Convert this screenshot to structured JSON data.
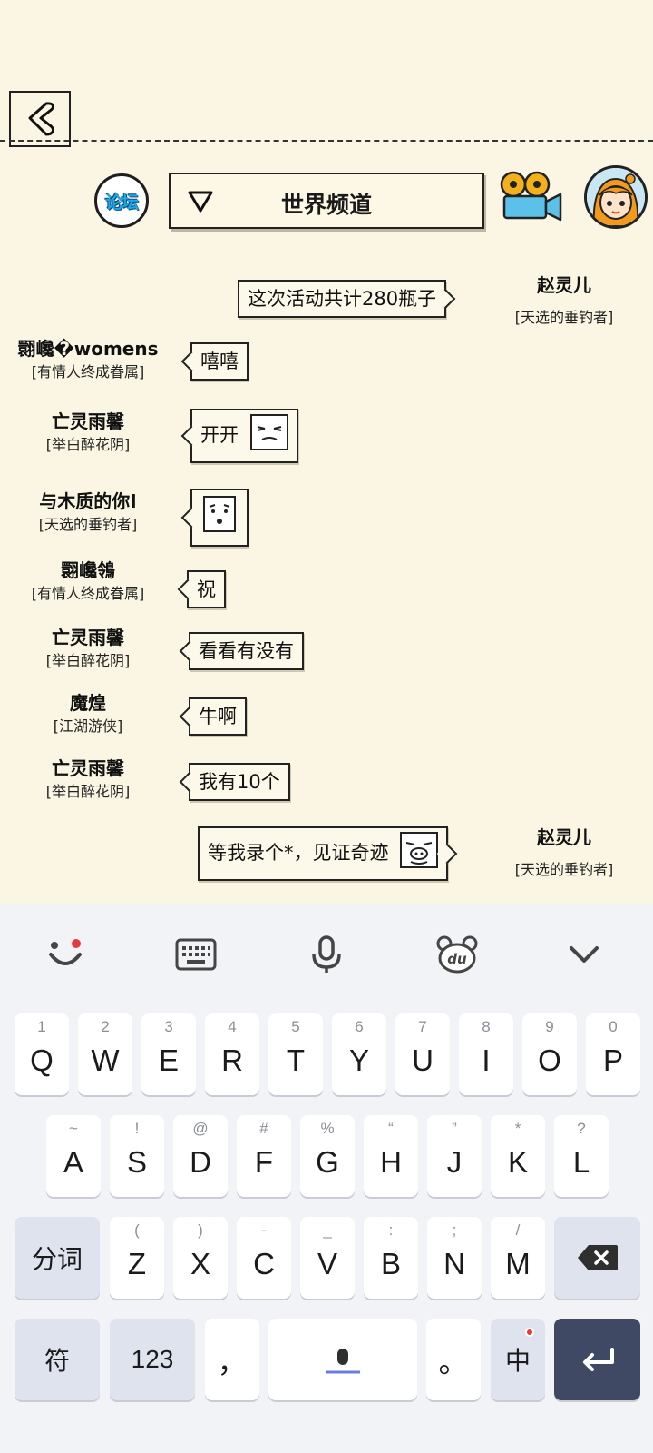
{
  "header": {
    "forum_label": "论坛",
    "channel_name": "世界频道"
  },
  "messages": [
    {
      "side": "right",
      "name": "赵灵儿",
      "title": "[天选的垂钓者]",
      "text": "这次活动共计280瓶子",
      "sticker": null
    },
    {
      "side": "left",
      "name": "翾巉�womens",
      "title": "[有情人终成眷属]",
      "text": "嘻嘻",
      "sticker": null
    },
    {
      "side": "left",
      "name": "亡灵雨馨",
      "title": "[举白醉花阴]",
      "text": "开开",
      "sticker": "squint-face"
    },
    {
      "side": "left",
      "name": "与木质的你I",
      "title": "[天选的垂钓者]",
      "text": "",
      "sticker": "blush-face"
    },
    {
      "side": "left",
      "name": "翾巉鴒",
      "title": "[有情人终成眷属]",
      "text": "祝",
      "sticker": null
    },
    {
      "side": "left",
      "name": "亡灵雨馨",
      "title": "[举白醉花阴]",
      "text": "看看有没有",
      "sticker": null
    },
    {
      "side": "left",
      "name": "魔煌",
      "title": "[江湖游侠]",
      "text": "牛啊",
      "sticker": null
    },
    {
      "side": "left",
      "name": "亡灵雨馨",
      "title": "[举白醉花阴]",
      "text": "我有10个",
      "sticker": null
    },
    {
      "side": "right",
      "name": "赵灵儿",
      "title": "[天选的垂钓者]",
      "text": "等我录个*，见证奇迹",
      "sticker": "pig-face"
    }
  ],
  "keyboard": {
    "toolbar": [
      "emoji-icon",
      "keyboard-icon",
      "microphone-icon",
      "du-bear-icon",
      "collapse-icon"
    ],
    "row1": [
      {
        "hint": "1",
        "key": "Q"
      },
      {
        "hint": "2",
        "key": "W"
      },
      {
        "hint": "3",
        "key": "E"
      },
      {
        "hint": "4",
        "key": "R"
      },
      {
        "hint": "5",
        "key": "T"
      },
      {
        "hint": "6",
        "key": "Y"
      },
      {
        "hint": "7",
        "key": "U"
      },
      {
        "hint": "8",
        "key": "I"
      },
      {
        "hint": "9",
        "key": "O"
      },
      {
        "hint": "0",
        "key": "P"
      }
    ],
    "row2": [
      {
        "hint": "~",
        "key": "A"
      },
      {
        "hint": "!",
        "key": "S"
      },
      {
        "hint": "@",
        "key": "D"
      },
      {
        "hint": "#",
        "key": "F"
      },
      {
        "hint": "%",
        "key": "G"
      },
      {
        "hint": "“",
        "key": "H"
      },
      {
        "hint": "”",
        "key": "J"
      },
      {
        "hint": "*",
        "key": "K"
      },
      {
        "hint": "?",
        "key": "L"
      }
    ],
    "row3": [
      {
        "hint": "(",
        "key": "Z"
      },
      {
        "hint": ")",
        "key": "X"
      },
      {
        "hint": "-",
        "key": "C"
      },
      {
        "hint": "_",
        "key": "V"
      },
      {
        "hint": ":",
        "key": "B"
      },
      {
        "hint": ";",
        "key": "N"
      },
      {
        "hint": "/",
        "key": "M"
      }
    ],
    "split_label": "分词",
    "symbol_label": "符",
    "number_label": "123",
    "comma_label": "，",
    "period_label": "。",
    "lang_label": "中"
  }
}
